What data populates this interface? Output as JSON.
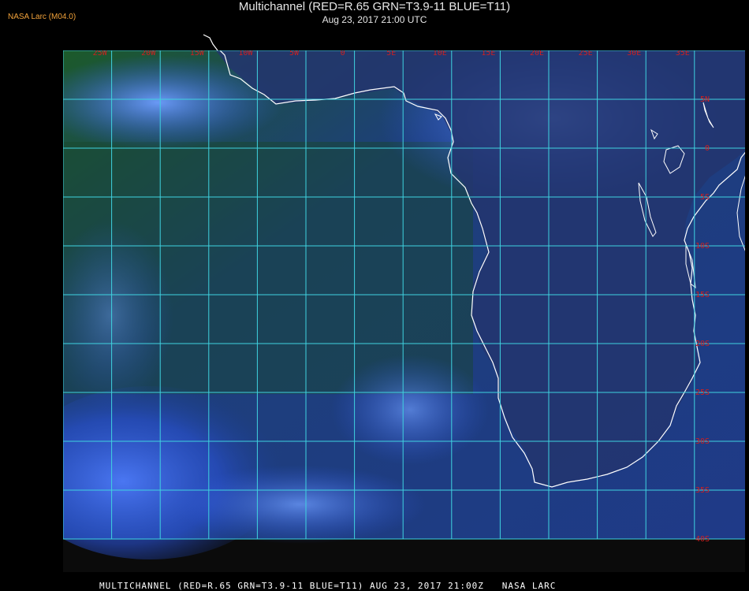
{
  "badge": "NASA Larc (M04.0)",
  "title": "Multichannel (RED=R.65 GRN=T3.9-11 BLUE=T11)",
  "subtitle": "Aug 23, 2017 21:00 UTC",
  "footer": "MULTICHANNEL (RED=R.65 GRN=T3.9-11 BLUE=T11) AUG 23, 2017 21:00Z   NASA LARC",
  "longitude_labels": [
    "25W",
    "20W",
    "15W",
    "10W",
    "5W",
    "0",
    "5E",
    "10E",
    "15E",
    "20E",
    "25E",
    "30E",
    "35E"
  ],
  "latitude_labels": [
    "5N",
    "0",
    "5S",
    "10S",
    "15S",
    "20S",
    "25S",
    "30S",
    "35S",
    "40S"
  ],
  "colors": {
    "grid": "#3fd3e0",
    "tick_label": "#d11f1f",
    "ocean": "#1f3f8f",
    "land": "#174818",
    "cloud": "#3f74ff",
    "coast": "#ffffff"
  }
}
